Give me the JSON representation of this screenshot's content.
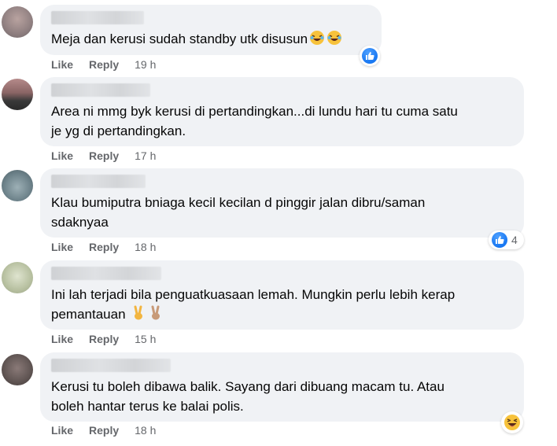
{
  "actions": {
    "like": "Like",
    "reply": "Reply"
  },
  "comments": [
    {
      "text": "Meja dan kerusi sudah standby utk disusun",
      "time": "19 h",
      "reaction": "like-icon",
      "reaction_count": ""
    },
    {
      "text": "Area ni mmg byk kerusi di pertandingkan...di lundu hari tu cuma satu\nje yg di pertandingkan.",
      "time": "17 h",
      "reaction": "",
      "reaction_count": ""
    },
    {
      "text": "Klau bumiputra bniaga kecil kecilan d pinggir jalan dibru/saman\nsdaknyaa",
      "time": "18 h",
      "reaction": "like-icon",
      "reaction_count": "4"
    },
    {
      "text": "Ini lah terjadi bila penguatkuasaan lemah. Mungkin perlu lebih kerap\npemantauan",
      "time": "15 h",
      "reaction": "",
      "reaction_count": ""
    },
    {
      "text": "Kerusi tu boleh dibawa balik. Sayang dari dibuang macam tu. Atau\nboleh hantar terus ke balai polis.",
      "time": "18 h",
      "reaction": "haha-icon",
      "reaction_count": ""
    }
  ],
  "colors": {
    "bubble": "#f0f2f5",
    "meta": "#65676b",
    "like_blue": "#1877f2"
  }
}
